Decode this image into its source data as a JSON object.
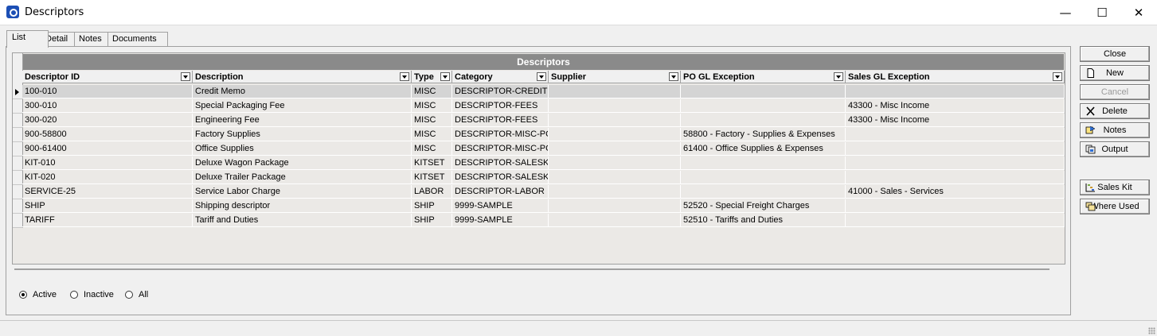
{
  "window": {
    "title": "Descriptors",
    "minimize": "—",
    "maximize": "☐",
    "close": "✕"
  },
  "tabs": [
    {
      "label": "List",
      "active": true
    },
    {
      "label": "Detail",
      "active": false
    },
    {
      "label": "Notes",
      "active": false
    },
    {
      "label": "Documents",
      "active": false
    }
  ],
  "grid": {
    "title": "Descriptors",
    "columns": [
      "Descriptor ID",
      "Description",
      "Type",
      "Category",
      "Supplier",
      "PO GL Exception",
      "Sales GL Exception"
    ],
    "rows": [
      [
        "100-010",
        "Credit Memo",
        "MISC",
        "DESCRIPTOR-CREDIT",
        "",
        "",
        ""
      ],
      [
        "300-010",
        "Special Packaging Fee",
        "MISC",
        "DESCRIPTOR-FEES",
        "",
        "",
        "43300 - Misc Income"
      ],
      [
        "300-020",
        "Engineering Fee",
        "MISC",
        "DESCRIPTOR-FEES",
        "",
        "",
        "43300 - Misc Income"
      ],
      [
        "900-58800",
        "Factory Supplies",
        "MISC",
        "DESCRIPTOR-MISC-PO",
        "",
        "58800 - Factory - Supplies & Expenses",
        ""
      ],
      [
        "900-61400",
        "Office Supplies",
        "MISC",
        "DESCRIPTOR-MISC-PO",
        "",
        "61400 - Office Supplies & Expenses",
        ""
      ],
      [
        "KIT-010",
        "Deluxe Wagon Package",
        "KITSET",
        "DESCRIPTOR-SALESKIT",
        "",
        "",
        ""
      ],
      [
        "KIT-020",
        "Deluxe Trailer Package",
        "KITSET",
        "DESCRIPTOR-SALESKIT",
        "",
        "",
        ""
      ],
      [
        "SERVICE-25",
        "Service Labor Charge",
        "LABOR",
        "DESCRIPTOR-LABOR",
        "",
        "",
        "41000 - Sales - Services"
      ],
      [
        "SHIP",
        "Shipping descriptor",
        "SHIP",
        "9999-SAMPLE",
        "",
        "52520 - Special Freight Charges",
        ""
      ],
      [
        "TARIFF",
        "Tariff and Duties",
        "SHIP",
        "9999-SAMPLE",
        "",
        "52510 - Tariffs and Duties",
        ""
      ]
    ],
    "selected_row": 0
  },
  "filter": {
    "options": [
      "Active",
      "Inactive",
      "All"
    ],
    "selected": "Active"
  },
  "buttons": {
    "close": "Close",
    "new": "New",
    "cancel": "Cancel",
    "delete": "Delete",
    "notes": "Notes",
    "output": "Output",
    "sales_kit": "Sales Kit",
    "where_used": "Where Used"
  },
  "colors": {
    "title_band": "#8a8a8a",
    "grid_bg": "#ebe9e6",
    "selected_row": "#d4d4d4",
    "app_icon": "#1c4fb5"
  }
}
